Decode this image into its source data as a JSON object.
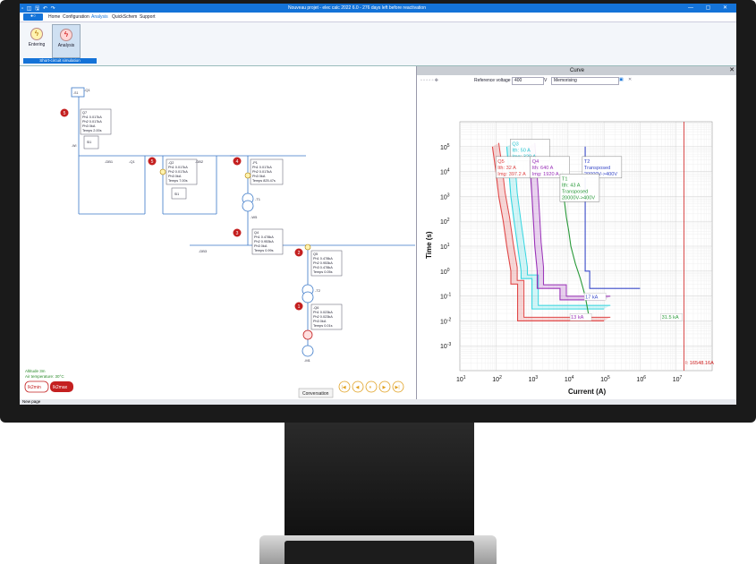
{
  "window": {
    "title": "Nouveau projet - elec calc 2022 6.0 - 276 days left before reactivation",
    "quick_access": "▫ ◫ 🖫 ↶ ↷",
    "file_tab": "●○",
    "controls": "— ▢ ✕"
  },
  "menu": {
    "items": [
      "Home",
      "Configuration",
      "Analysis",
      "QuickSchem",
      "Support"
    ]
  },
  "ribbon": {
    "entering_label": "Entering",
    "analysis_label": "Analysis",
    "group_label": "Short-circuit simulation"
  },
  "diagram": {
    "labels": {
      "q1": "-Q1",
      "q7": "Q7",
      "db1": "-DB1",
      "qa": "-Q1",
      "q2": "-Q2",
      "db2": "-DB2",
      "jp1": "-P1",
      "t1": "-T1",
      "w5": "-W5",
      "q4": "Q4",
      "db3": "-DB3",
      "q5": "Q5",
      "t2": "-T2",
      "q6": "-Q6",
      "m1": "-M1",
      "wi": "-WI"
    },
    "markers": {
      "m5a": "5",
      "m5b": "5",
      "m4": "4",
      "m3": "3",
      "m2": "2",
      "m1": "1"
    },
    "boxes": {
      "q7": [
        "Q7",
        "Ph1   0.017kA",
        "Ph2   0.017kA",
        "Ph3         0kA",
        "Temps  2.00s"
      ],
      "q2": [
        "-Q2",
        "Ph1   0.017kA",
        "Ph2   0.017kA",
        "Ph3         0kA",
        "Temps  7.00s"
      ],
      "p1": [
        "-P1",
        "Ph1   0.017kA",
        "Ph2   0.017kA",
        "Ph3         0kA",
        "Temps  825.47s"
      ],
      "q4": [
        "Q4",
        "Ph1   0.478kA",
        "Ph2   0.953kA",
        "Ph3         0kA",
        "Temps  0.99s"
      ],
      "q5": [
        "Q5",
        "Ph1   0.478kA",
        "Ph2   0.953kA",
        "Ph3   0.478kA",
        "Temps  0.05s"
      ],
      "q6": [
        "-Q6",
        "Ph1   0.023kA",
        "Ph2   0.023kA",
        "Ph3         0kA",
        "Temps  0.01s"
      ]
    },
    "small_boxes": {
      "b1": "SI1",
      "b2": "SI1",
      "src": "-S1"
    },
    "info": {
      "altitude": "Altitude 3m",
      "air_temp": "Air temperature: 30°C"
    },
    "ik_min": "Ik2min",
    "ik_max": "Ik2max",
    "tooltip": "Conversation",
    "player": [
      "|◀",
      "◀",
      "⏸",
      "▶",
      "▶|"
    ]
  },
  "curve": {
    "title": "Curve",
    "close": "✕",
    "toolbar": {
      "icons": "▫ ▫ ▫ ▫ ▫ ✥",
      "ref_label": "Reference voltage",
      "ref_value": "400",
      "unit": "V",
      "memo_label": "Memorising"
    }
  },
  "chart_data": {
    "type": "line",
    "xlabel": "Current (A)",
    "ylabel": "Time (s)",
    "xscale": "log",
    "yscale": "log",
    "xlim": [
      10,
      100000000
    ],
    "ylim": [
      0.0001,
      1000000
    ],
    "xticks": [
      "10^1",
      "10^2",
      "10^3",
      "10^4",
      "10^5",
      "10^6",
      "10^7"
    ],
    "yticks": [
      "10^5",
      "10^4",
      "10^3",
      "10^2",
      "10^1",
      "10^0",
      "10^-1",
      "10^-2",
      "10^-3"
    ],
    "grid": true,
    "series": [
      {
        "name": "Q5",
        "color": "#e04848",
        "band": true,
        "x": [
          80,
          100,
          120,
          160,
          200,
          260,
          260,
          400,
          400,
          100000
        ],
        "y": [
          100000,
          10000,
          1000,
          100,
          10,
          1,
          0.3,
          0.3,
          0.01,
          0.01
        ]
      },
      {
        "name": "Q3",
        "color": "#36d6e0",
        "band": true,
        "x": [
          200,
          230,
          260,
          320,
          400,
          500,
          500,
          1000,
          1000,
          100000
        ],
        "y": [
          100000,
          10000,
          1000,
          100,
          10,
          1,
          0.5,
          0.5,
          0.03,
          0.03
        ]
      },
      {
        "name": "Q4",
        "color": "#9a32b8",
        "band": true,
        "x": [
          800,
          900,
          1000,
          1100,
          1200,
          1400,
          1400,
          6000,
          6000,
          100000
        ],
        "y": [
          100000,
          10000,
          1000,
          100,
          10,
          1,
          0.2,
          0.2,
          0.07,
          0.07
        ]
      },
      {
        "name": "T1",
        "color": "#2a9a3a",
        "band": false,
        "x": [
          7000,
          7200,
          7500,
          8000,
          9000,
          10500,
          12000,
          16000,
          22000,
          30000,
          40000
        ],
        "y": [
          10000,
          5000,
          2000,
          600,
          150,
          40,
          10,
          2,
          0.5,
          0.1,
          0.01
        ]
      },
      {
        "name": "T2",
        "color": "#3a4ac8",
        "band": false,
        "x": [
          30000,
          30000,
          40000,
          40000,
          1000000
        ],
        "y": [
          100000,
          1,
          1,
          0.2,
          0.2
        ]
      }
    ],
    "annotations": [
      {
        "lines": [
          "Q3",
          "Ith: 50 A",
          "Img: 320 A"
        ],
        "color": "#25c4cf"
      },
      {
        "lines": [
          "Q5",
          "Ith: 32 A",
          "Img: 397.2 A"
        ],
        "color": "#e04848"
      },
      {
        "lines": [
          "Q4",
          "Ith: 640 A",
          "Img: 1920 A"
        ],
        "color": "#9a32b8"
      },
      {
        "lines": [
          "T2",
          "Transposed",
          "20000V->400V"
        ],
        "color": "#3a4ac8"
      },
      {
        "lines": [
          "T1",
          "Ith: 43 A",
          "Transposed",
          "20000V->400V"
        ],
        "color": "#2a9a3a"
      }
    ],
    "value_labels": [
      {
        "text": "17 kA",
        "color": "#3a4ac8"
      },
      {
        "text": "13 kA",
        "color": "#9a32b8"
      },
      {
        "text": "31.5 kA",
        "color": "#2a9a3a"
      },
      {
        "text": "I: 16548.16A",
        "color": "#d02020"
      }
    ]
  },
  "status": {
    "page_tab": "New page"
  }
}
